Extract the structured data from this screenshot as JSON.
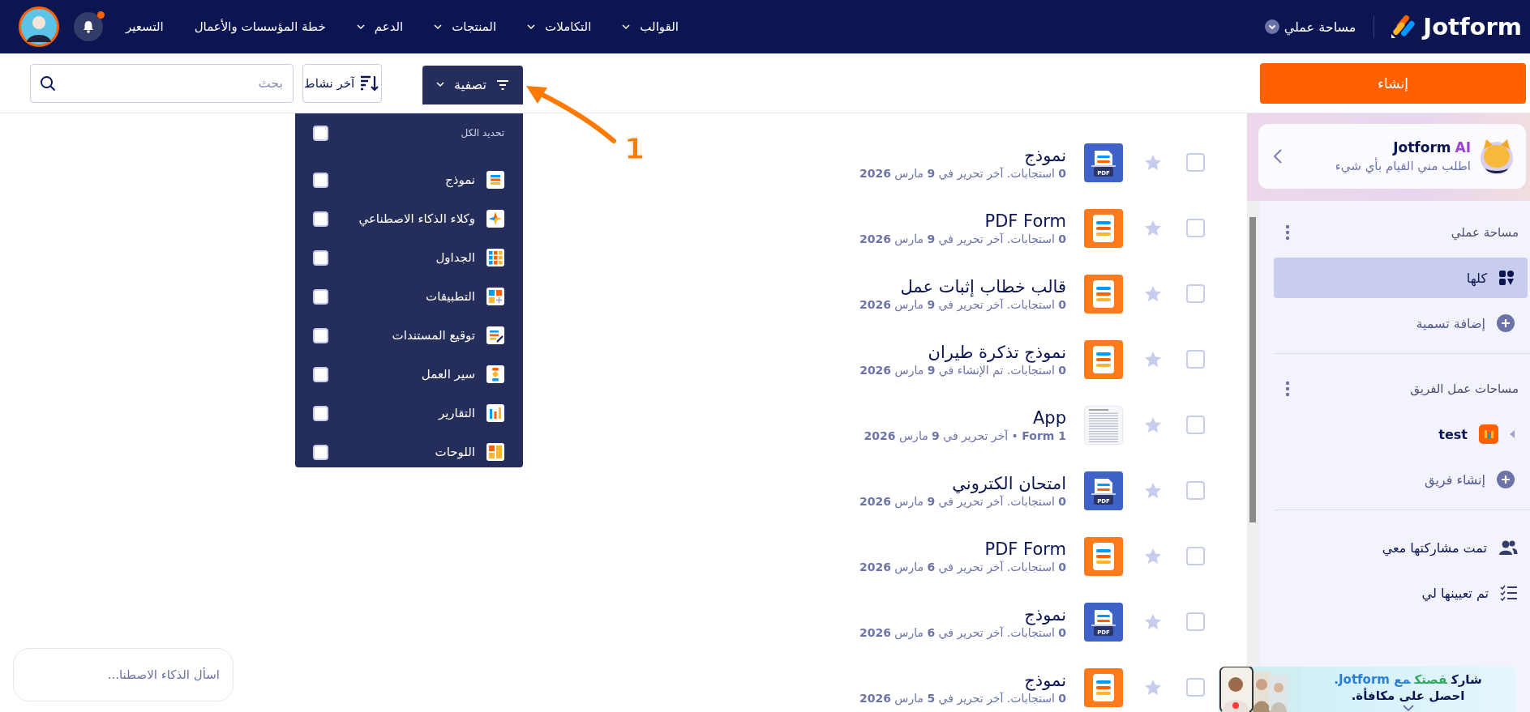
{
  "topbar": {
    "logo": "Jotform",
    "workspace_menu": "مساحة عملي",
    "nav": [
      {
        "label": "القوالب",
        "has_menu": true
      },
      {
        "label": "التكاملات",
        "has_menu": true
      },
      {
        "label": "المنتجات",
        "has_menu": true
      },
      {
        "label": "الدعم",
        "has_menu": true
      },
      {
        "label": "خطة المؤسسات والأعمال",
        "has_menu": false
      },
      {
        "label": "التسعير",
        "has_menu": false
      }
    ],
    "notifications_unread": true
  },
  "toolbar": {
    "create_button": "إنشاء",
    "filter_button": {
      "label": "تصفية",
      "expanded": true
    },
    "sort_button": "آخر نشاط",
    "search": {
      "placeholder": "بحث"
    }
  },
  "filter_menu": {
    "select_all": {
      "label": "تحديد الكل",
      "checked": false
    },
    "options": [
      {
        "label": "نموذج",
        "kind": "form",
        "checked": false
      },
      {
        "label": "وكلاء الذكاء الاصطناعي",
        "kind": "agent",
        "checked": false
      },
      {
        "label": "الجداول",
        "kind": "table",
        "checked": false
      },
      {
        "label": "التطبيقات",
        "kind": "app",
        "checked": false
      },
      {
        "label": "توقيع المستندات",
        "kind": "sign",
        "checked": false
      },
      {
        "label": "سير العمل",
        "kind": "workflow",
        "checked": false
      },
      {
        "label": "التقارير",
        "kind": "report",
        "checked": false
      },
      {
        "label": "اللوحات",
        "kind": "board",
        "checked": false
      }
    ]
  },
  "annotation": {
    "label": "1"
  },
  "items": [
    {
      "title": "نموذج",
      "meta": "**0** استجابات. آخر تحرير في **9** مارس **2026**",
      "kind": "pdf",
      "icon_label": "PDF",
      "starred": false,
      "checked": false
    },
    {
      "title": "PDF Form",
      "meta": "**0** استجابات. آخر تحرير في **9** مارس **2026**",
      "kind": "form",
      "starred": false,
      "checked": false
    },
    {
      "title": "قالب خطاب إثبات عمل",
      "meta": "**0** استجابات. آخر تحرير في **9** مارس **2026**",
      "kind": "form",
      "starred": false,
      "checked": false
    },
    {
      "title": "نموذج تذكرة طيران",
      "meta": "**0** استجابات. تم الإنشاء في **9** مارس **2026**",
      "kind": "form",
      "starred": false,
      "checked": false
    },
    {
      "title": "App",
      "meta": "**1 Form** • آخر تحرير في **9** مارس **2026**",
      "kind": "app",
      "starred": false,
      "checked": false
    },
    {
      "title": "امتحان الكتروني",
      "meta": "**0** استجابات. آخر تحرير في **9** مارس **2026**",
      "kind": "pdf",
      "icon_label": "PDF",
      "starred": false,
      "checked": false
    },
    {
      "title": "PDF Form",
      "meta": "**0** استجابات. آخر تحرير في **6** مارس **2026**",
      "kind": "form",
      "starred": false,
      "checked": false
    },
    {
      "title": "نموذج",
      "meta": "**0** استجابات. آخر تحرير في **6** مارس **2026**",
      "kind": "pdf",
      "icon_label": "PDF",
      "starred": false,
      "checked": false
    },
    {
      "title": "نموذج",
      "meta": "**0** استجابات. آخر تحرير في **5** مارس **2026**",
      "kind": "form",
      "starred": false,
      "checked": false
    }
  ],
  "sidebar": {
    "ai_card": {
      "brand": "Jotform",
      "badge": "AI",
      "subtitle": "اطلب مني القيام بأي شيء"
    },
    "my_workspace": {
      "heading": "مساحة عملي",
      "items": [
        {
          "label": "كلها",
          "kind": "all",
          "selected": true
        },
        {
          "label": "إضافة تسمية",
          "kind": "add",
          "selected": false
        }
      ]
    },
    "team_workspaces": {
      "heading": "مساحات عمل الفريق",
      "items": [
        {
          "label": "test",
          "kind": "team",
          "selected": false
        },
        {
          "label": "إنشاء فريق",
          "kind": "add",
          "selected": false
        }
      ]
    },
    "shared": [
      {
        "label": "تمت مشاركتها معي",
        "kind": "shared",
        "selected": false
      },
      {
        "label": "تم تعيينها لي",
        "kind": "assigned",
        "selected": false
      }
    ]
  },
  "ask_ai": {
    "placeholder": "اسأل الذكاء الاصطنا..."
  },
  "promo": {
    "headline": [
      {
        "text": "شارك",
        "color": "#0a1551"
      },
      {
        "text": "قصتك",
        "color": "#2eaa5c"
      },
      {
        "text": "مع Jotform.",
        "color": "#2a7fd4"
      }
    ],
    "subline": "احصل على مكافأة."
  }
}
